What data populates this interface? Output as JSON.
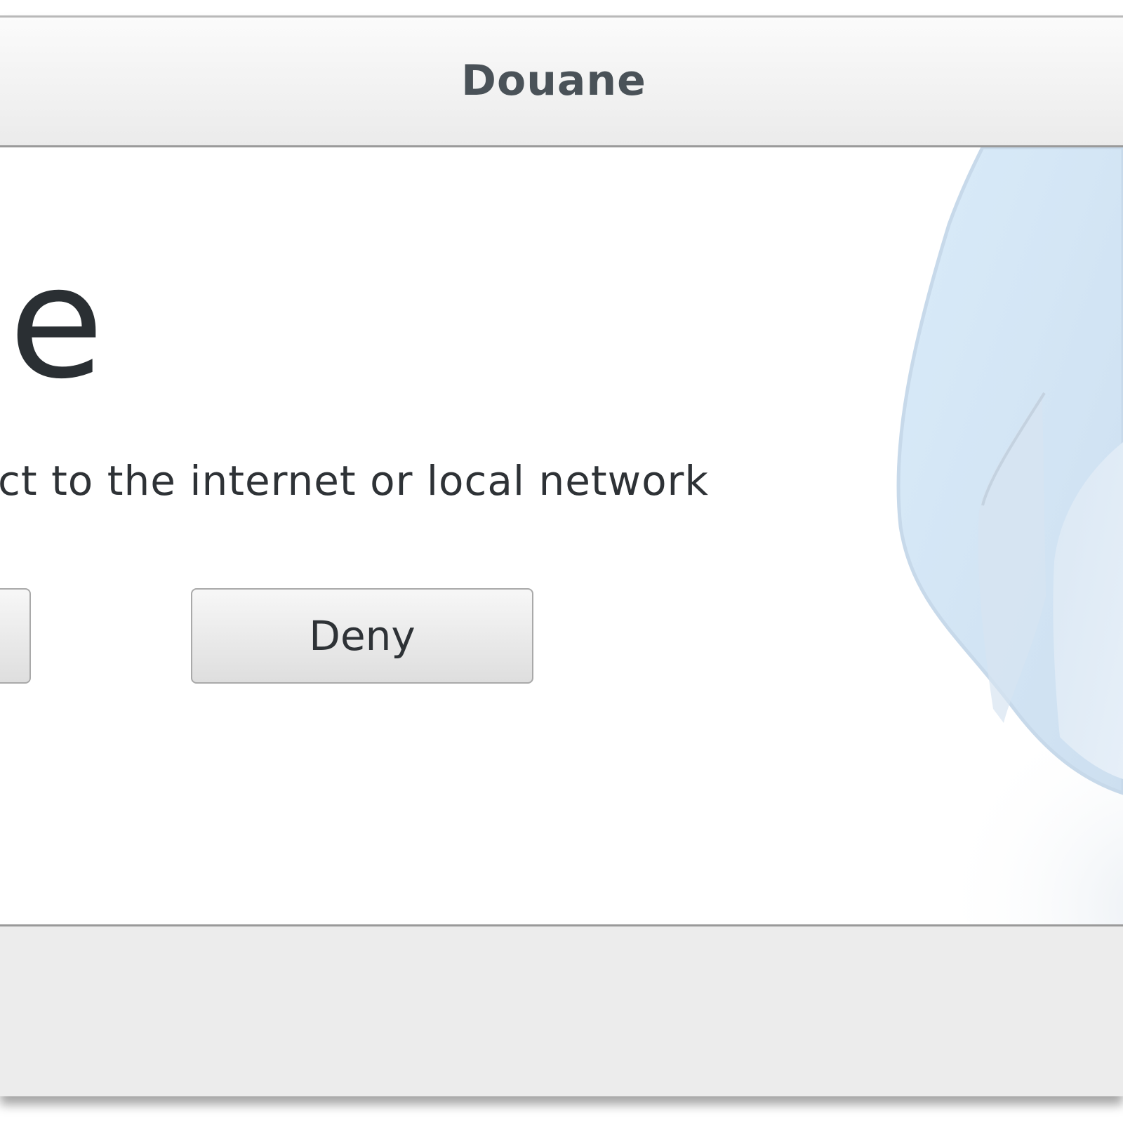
{
  "window": {
    "title": "Douane"
  },
  "main": {
    "app_name": "ie",
    "description": "ct to the internet or local network",
    "buttons": {
      "deny_label": "Deny"
    }
  },
  "colors": {
    "title_text": "#4a5258",
    "body_text": "#2e3236",
    "artwork_blue": "#d6e8f7"
  },
  "icons": {
    "artwork": "douane-shield-artwork"
  }
}
